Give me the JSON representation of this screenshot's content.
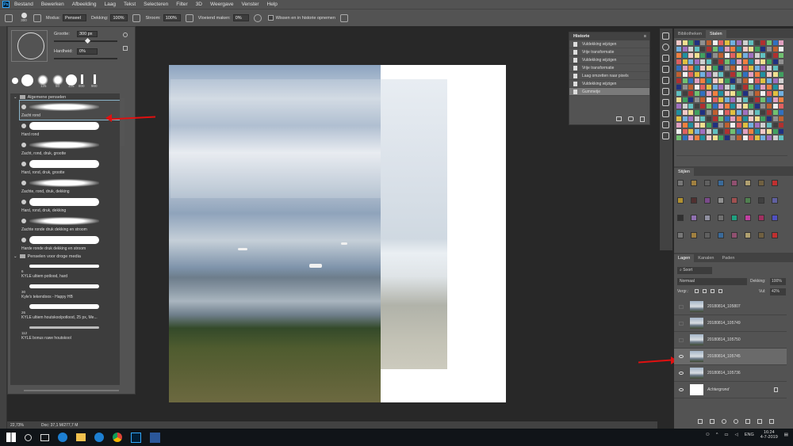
{
  "menubar": {
    "app_icon": "Ps",
    "items": [
      "Bestand",
      "Bewerken",
      "Afbeelding",
      "Laag",
      "Tekst",
      "Selecteren",
      "Filter",
      "3D",
      "Weergave",
      "Venster",
      "Help"
    ]
  },
  "optionsbar": {
    "brush_size": "300",
    "mode_label": "Modus:",
    "mode_value": "Penseel",
    "opacity_label": "Dekking:",
    "opacity_value": "100%",
    "flow_label": "Stroom:",
    "flow_value": "100%",
    "smoothing_label": "Vloeiend maken:",
    "smoothing_value": "0%",
    "history_checkbox_label": "Wissen en in historie opnemen"
  },
  "brushpanel": {
    "size_label": "Grootte:",
    "size_value": "300 px",
    "hardness_label": "Hardheid:",
    "hardness_value": "0%",
    "preset_sizes": [
      "",
      "",
      "125",
      "50",
      "125",
      "800",
      "900"
    ],
    "folder1": "Algemene penselen",
    "brushes1": [
      "Zacht rond",
      "Hard rond",
      "Zacht, rond, druk, grootte",
      "Hard, rond, druk, grootte",
      "Zachte, rond, druk, dekking",
      "Hard, rond, druk, dekking",
      "Zachte ronde druk dekking en stroom",
      "Harde ronde druk dekking en stroom"
    ],
    "folder2": "Penselen voor droge media",
    "brushes2": [
      {
        "size": "6",
        "label": "KYLE ultiem potlood, hard"
      },
      {
        "size": "30",
        "label": "Kyle's tekendoos - Happy HB"
      },
      {
        "size": "26",
        "label": "KYLE ultiem houtskoolpotlood, 25 px, Me..."
      },
      {
        "size": "112",
        "label": "KYLE bonus ruwe houtskool"
      }
    ]
  },
  "history": {
    "title": "Historie",
    "items": [
      "Vuldekking wijzigen",
      "Vrije transformatie",
      "Vuldekking wijzigen",
      "Vrije transformatie",
      "Laag omzetten naar pixels",
      "Vuldekking wijzigen",
      "Gummetje"
    ]
  },
  "rightpanel": {
    "tabs_top": [
      "Bibliotheken",
      "Stalen"
    ],
    "styles_title": "Stijlen",
    "tabs_layers": [
      "Lagen",
      "Kanalen",
      "Paden"
    ],
    "filter_label": "Soort",
    "blend_mode": "Normaal",
    "opacity_label": "Dekking:",
    "opacity_value": "100%",
    "lock_label": "Vergr.:",
    "fill_label": "Vul:",
    "fill_value": "42%",
    "layers": [
      {
        "name": "20180814_105807",
        "visible": false,
        "selected": false
      },
      {
        "name": "20180814_105749",
        "visible": false,
        "selected": false
      },
      {
        "name": "20180814_105750",
        "visible": false,
        "selected": false
      },
      {
        "name": "20180814_105745",
        "visible": true,
        "selected": true
      },
      {
        "name": "20180814_105736",
        "visible": true,
        "selected": false
      },
      {
        "name": "Achtergrond",
        "visible": true,
        "selected": false
      }
    ]
  },
  "status": {
    "zoom": "22,73%",
    "doc": "Doc: 37,1 M/277,7 M"
  },
  "taskbar": {
    "language": "ENG",
    "time": "16:24",
    "date": "4-7-2019"
  }
}
